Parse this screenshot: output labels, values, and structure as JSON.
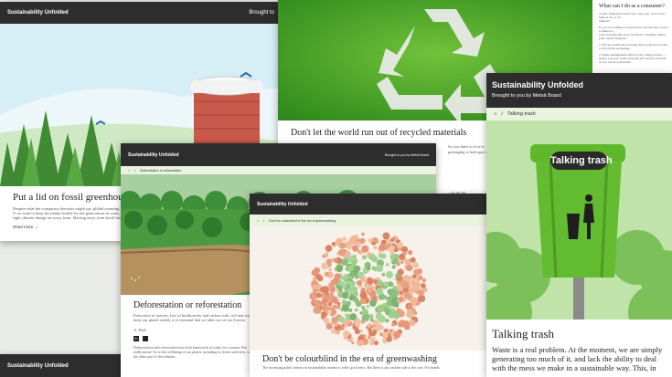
{
  "brand_color": "#2d2d2d",
  "accent_green": "#5aa02c",
  "card1": {
    "brand": "Sustainability Unfolded",
    "header_right": "Brought to",
    "title": "Put a lid on fossil greenhouse",
    "body1": "Despite what the conspiracy theorists might say, global warming is a real",
    "body2": "If we want to keep the planet livable for the generations to come, we need",
    "body3": "fight climate change on every front. Moving away from fossil fuels is one",
    "read_more": "Read more"
  },
  "card2": {
    "title": "Don't let the world run out of recycled materials",
    "sidebar_heading": "What can I do as a consumer?",
    "sidebar_body1": "A New England proverb says \"use it up, wear it out, make it do, or do",
    "sidebar_body2": "without.\"",
    "sidebar_body3": "If you are looking for some more concrete tips on how to improve",
    "sidebar_body4": "your everyday life, here are three to instantly reduce your carbon footprint:",
    "list1": "1. Favour brands that package their goods in recycled or recyclable packaging.",
    "list2": "2. Waste management affects every single person — ensure you sort, reuse and pack and recycle as much as you can in your home.",
    "side_frag1": "...or, as we",
    "side_frag2": "So you have to love it. So",
    "side_frag3": "packaging is both part of the"
  },
  "card3": {
    "brand": "Sustainability Unfolded",
    "header_right": "Brought to you by Metsä Board",
    "crumb_label": "Deforestation or reforestation",
    "title": "Deforestation or reforestation",
    "body1": "Extinction of species, loss of biodiversity and carbon sink, soil and water",
    "body2": "keep our planet viable, it is essential that we take care of our forests.",
    "author": "A. Hirk",
    "body3": "Deforestation and reforestation are both buzzwords of today for a reason. But",
    "body4": "really mean? As to the wellbeing of our planet, including its leaves and trees, we",
    "body5": "the other part of the solution."
  },
  "card4": {
    "brand": "Sustainability Unfolded",
    "crumb_label": "Don't be colourblind in the era of greenwashing",
    "title": "Don't be colourblind in the era of greenwashing",
    "body": "The increasing public interest in sustainability matters is really good news. But there is also another side to the coin. For brands"
  },
  "card5": {
    "brand": "Sustainability Unfolded"
  },
  "card6": {
    "brand": "Sustainability Unfolded",
    "subtitle": "Brought to you by Metsä Board",
    "crumb_label": "Talking trash",
    "sign_text": "Talking trash",
    "title": "Talking trash",
    "body1": "Waste is a real problem. At the moment, we are simply",
    "body2": "generating too much of it, and lack the ability to deal",
    "body3": "with the mess we make in a sustainable way. This, in"
  }
}
